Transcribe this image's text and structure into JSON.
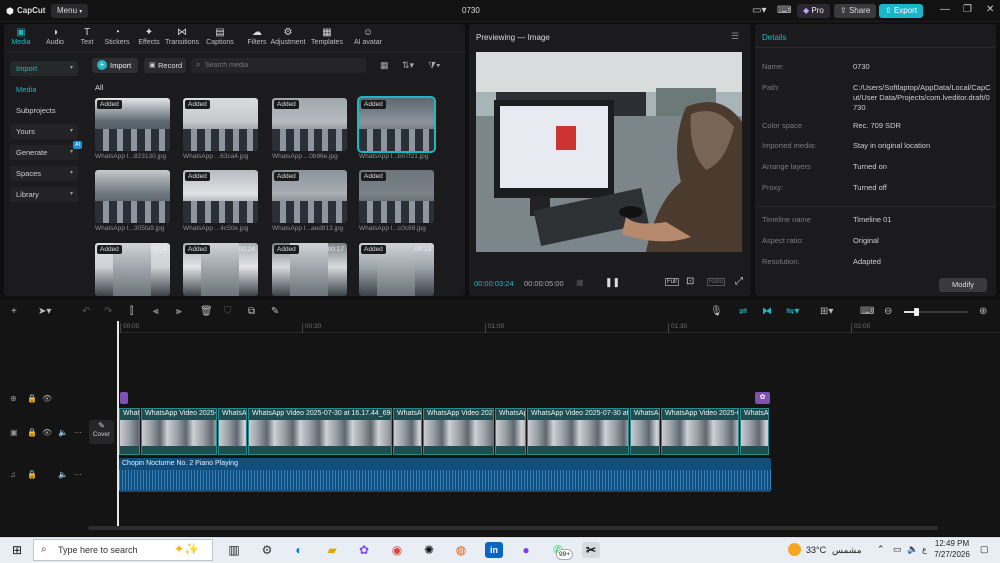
{
  "app": {
    "name": "CapCut",
    "menu_label": "Menu",
    "project_title": "0730",
    "pro_label": "Pro",
    "share_label": "Share",
    "export_label": "Export"
  },
  "toolbar": [
    {
      "label": "Media",
      "icon": "media-icon",
      "active": true
    },
    {
      "label": "Audio",
      "icon": "audio-icon"
    },
    {
      "label": "Text",
      "icon": "text-icon"
    },
    {
      "label": "Stickers",
      "icon": "stickers-icon"
    },
    {
      "label": "Effects",
      "icon": "effects-icon"
    },
    {
      "label": "Transitions",
      "icon": "transitions-icon"
    },
    {
      "label": "Captions",
      "icon": "captions-icon"
    },
    {
      "label": "Filters",
      "icon": "filters-icon"
    },
    {
      "label": "Adjustment",
      "icon": "adjustment-icon"
    },
    {
      "label": "Templates",
      "icon": "templates-icon"
    },
    {
      "label": "AI avatar",
      "icon": "ai-avatar-icon"
    }
  ],
  "sidebar": {
    "items": [
      {
        "label": "Import",
        "chevron": true,
        "active": true
      },
      {
        "label": "Media",
        "active": true
      },
      {
        "label": "Subprojects"
      },
      {
        "label": "Yours",
        "chevron": true
      },
      {
        "label": "Generate",
        "chevron": true,
        "badge": "AI"
      },
      {
        "label": "Spaces",
        "chevron": true
      },
      {
        "label": "Library",
        "chevron": true
      }
    ]
  },
  "media": {
    "import_label": "Import",
    "record_label": "Record",
    "search_placeholder": "Search media",
    "filter_all": "All",
    "items": [
      {
        "tag": "Added",
        "name": "WhatsApp I...823130.jpg"
      },
      {
        "tag": "Added",
        "name": "WhatsApp ...63ca4.jpg"
      },
      {
        "tag": "Added",
        "name": "WhatsApp ...0b96e.jpg"
      },
      {
        "tag": "Added",
        "name": "WhatsApp I...b07f21.jpg",
        "selected": true
      },
      {
        "tag": "",
        "name": "WhatsApp I...305fa9.jpg"
      },
      {
        "tag": "Added",
        "name": "WhatsApp ...4c50e.jpg"
      },
      {
        "tag": "Added",
        "name": "WhatsApp I...aed813.jpg"
      },
      {
        "tag": "Added",
        "name": "WhatsApp I...c0c69.jpg"
      },
      {
        "tag": "Added",
        "name": "",
        "duration": "00:14"
      },
      {
        "tag": "Added",
        "name": "",
        "duration": "00:24"
      },
      {
        "tag": "Added",
        "name": "",
        "duration": "00:17"
      },
      {
        "tag": "Added",
        "name": "",
        "duration": "00:13"
      }
    ]
  },
  "preview": {
    "title": "Previewing — Image",
    "current_time": "00:00:03:24",
    "total_time": "00:00:05:00",
    "full_label": "Full",
    "ratio_label": "Ratio"
  },
  "details": {
    "title": "Details",
    "rows": [
      {
        "label": "Name:",
        "value": "0730"
      },
      {
        "label": "Path:",
        "value": "C:/Users/Softlaptop/AppData/Local/CapCut/User Data/Projects/com.lveditor.draft/0730"
      },
      {
        "label": "Color space",
        "value": "Rec. 709 SDR"
      },
      {
        "label": "Imported media:",
        "value": "Stay in original location"
      },
      {
        "label": "Arrange layers",
        "value": "Turned on"
      },
      {
        "label": "Proxy:",
        "value": "Turned off"
      },
      {
        "label": "Timeline name",
        "value": "Timeline 01"
      },
      {
        "label": "Aspect ratio:",
        "value": "Original"
      },
      {
        "label": "Resolution:",
        "value": "Adapted"
      }
    ],
    "modify_label": "Modify"
  },
  "timeline": {
    "ruler": [
      "00:00",
      "00:30",
      "01:00",
      "01:30",
      "02:00"
    ],
    "cover_label": "Cover",
    "clips": [
      {
        "label": "What",
        "width": 22
      },
      {
        "label": "WhatsApp Video 2025-0",
        "width": 77
      },
      {
        "label": "WhatsAp",
        "width": 30
      },
      {
        "label": "WhatsApp Video 2025-07-30 at 16.17.44_69d2",
        "width": 145
      },
      {
        "label": "WhatsAp",
        "width": 30
      },
      {
        "label": "WhatsApp Video 2025",
        "width": 72
      },
      {
        "label": "WhatsAp",
        "width": 32
      },
      {
        "label": "WhatsApp Video 2025-07-30 at",
        "width": 103
      },
      {
        "label": "WhatsAp",
        "width": 31
      },
      {
        "label": "WhatsApp Video 2025-0",
        "width": 79
      },
      {
        "label": "WhatsAp",
        "width": 30
      }
    ],
    "audio_label": "Chopin Nocturne No. 2 Piano Playing"
  },
  "taskbar": {
    "search_placeholder": "Type here to search",
    "weather_temp": "33°C",
    "weather_text": "مشمس",
    "time": "12:49 PM",
    "date": "7/27/2026",
    "whatsapp_badge": "99+"
  },
  "colors": {
    "accent": "#1fb7c4",
    "export_bg": "#19b5c8",
    "clip_bg": "#1f4e50",
    "audio_bg": "#124e7c"
  }
}
